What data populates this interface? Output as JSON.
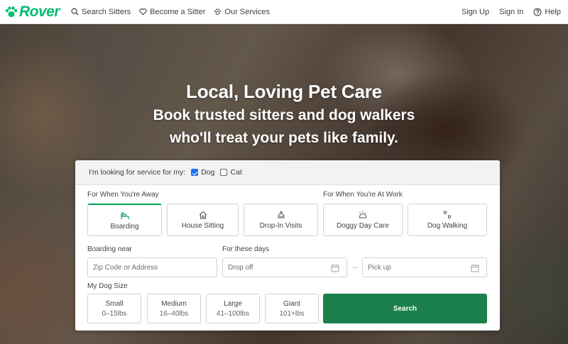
{
  "brand": {
    "name": "Rover",
    "color": "#00bd70"
  },
  "nav": {
    "left": [
      {
        "label": "Search Sitters",
        "icon": "search-icon"
      },
      {
        "label": "Become a Sitter",
        "icon": "heart-icon"
      },
      {
        "label": "Our Services",
        "icon": "paw-icon"
      }
    ],
    "right": [
      {
        "label": "Sign Up"
      },
      {
        "label": "Sign In"
      },
      {
        "label": "Help",
        "icon": "help-circle-icon"
      }
    ]
  },
  "hero": {
    "title": "Local, Loving Pet Care",
    "subtitle_line1": "Book trusted sitters and dog walkers",
    "subtitle_line2": "who'll treat your pets like family."
  },
  "search": {
    "pet_prompt": "I'm looking for service for my:",
    "pets": [
      {
        "label": "Dog",
        "checked": true
      },
      {
        "label": "Cat",
        "checked": false
      }
    ],
    "away_label": "For When You're Away",
    "work_label": "For When You're At Work",
    "services": [
      {
        "label": "Boarding",
        "icon": "boarding-icon",
        "selected": true
      },
      {
        "label": "House Sitting",
        "icon": "house-icon",
        "selected": false
      },
      {
        "label": "Drop-In Visits",
        "icon": "drop-in-icon",
        "selected": false
      },
      {
        "label": "Doggy Day Care",
        "icon": "day-care-icon",
        "selected": false
      },
      {
        "label": "Dog Walking",
        "icon": "paw-prints-icon",
        "selected": false
      }
    ],
    "location_label": "Boarding near",
    "location_placeholder": "Zip Code or Address",
    "dates_label": "For these days",
    "dropoff_placeholder": "Drop off",
    "pickup_placeholder": "Pick up",
    "size_label": "My Dog Size",
    "sizes": [
      {
        "name": "Small",
        "range": "0–15lbs"
      },
      {
        "name": "Medium",
        "range": "16–40lbs"
      },
      {
        "name": "Large",
        "range": "41–100lbs"
      },
      {
        "name": "Giant",
        "range": "101+lbs"
      }
    ],
    "search_button": "Search",
    "button_color": "#1b7f4c"
  }
}
